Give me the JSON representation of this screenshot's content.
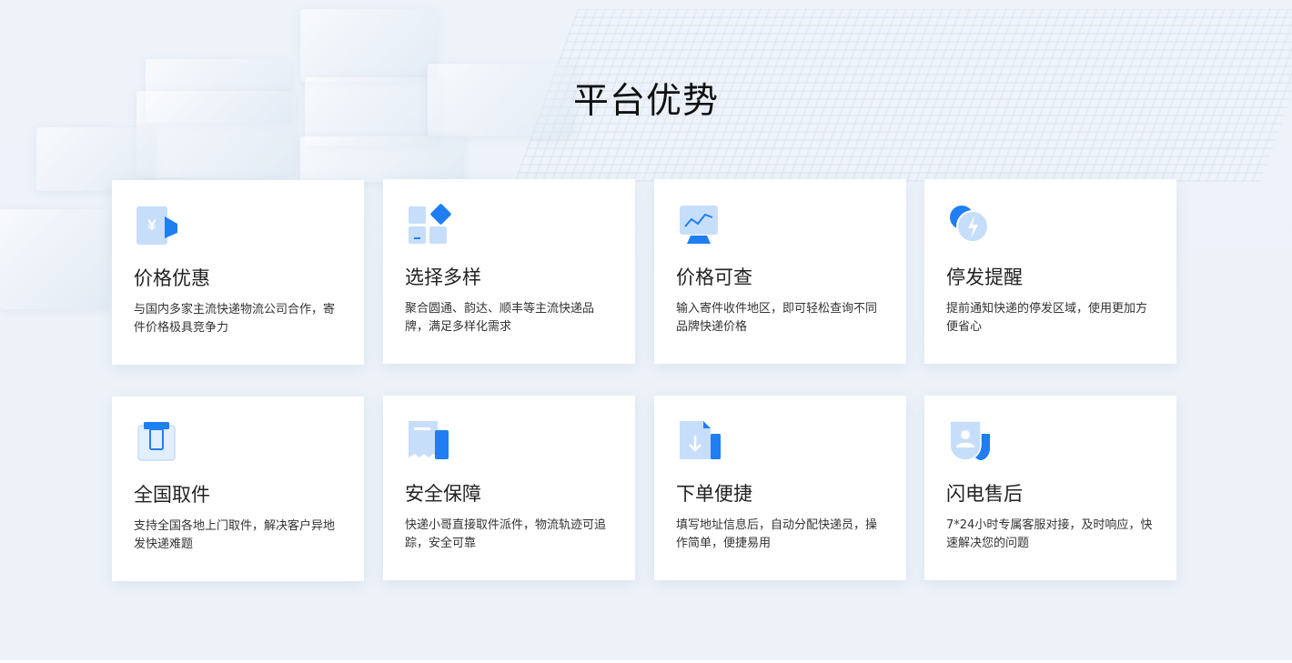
{
  "section": {
    "title": "平台优势",
    "cards": [
      {
        "title": "价格优惠",
        "desc": "与国内多家主流快递物流公司合作，寄件价格极具竞争力",
        "icon": "yen-tag-icon"
      },
      {
        "title": "选择多样",
        "desc": "聚合圆通、韵达、顺丰等主流快递品牌，满足多样化需求",
        "icon": "grid-diamond-icon"
      },
      {
        "title": "价格可查",
        "desc": "输入寄件收件地区，即可轻松查询不同品牌快递价格",
        "icon": "chart-monitor-icon"
      },
      {
        "title": "停发提醒",
        "desc": "提前通知快递的停发区域，使用更加方便省心",
        "icon": "lightning-bubble-icon"
      },
      {
        "title": "全国取件",
        "desc": "支持全国各地上门取件，解决客户异地发快递难题",
        "icon": "pickup-box-icon"
      },
      {
        "title": "安全保障",
        "desc": "快递小哥直接取件派件，物流轨迹可追踪，安全可靠",
        "icon": "receipt-shield-icon"
      },
      {
        "title": "下单便捷",
        "desc": "填写地址信息后，自动分配快递员，操作简单，便捷易用",
        "icon": "download-document-icon"
      },
      {
        "title": "闪电售后",
        "desc": "7*24小时专属客服对接，及时响应，快速解决您的问题",
        "icon": "user-shield-icon"
      }
    ]
  },
  "colors": {
    "accent": "#1f7ef2",
    "accent_light": "#bcd8fb"
  }
}
